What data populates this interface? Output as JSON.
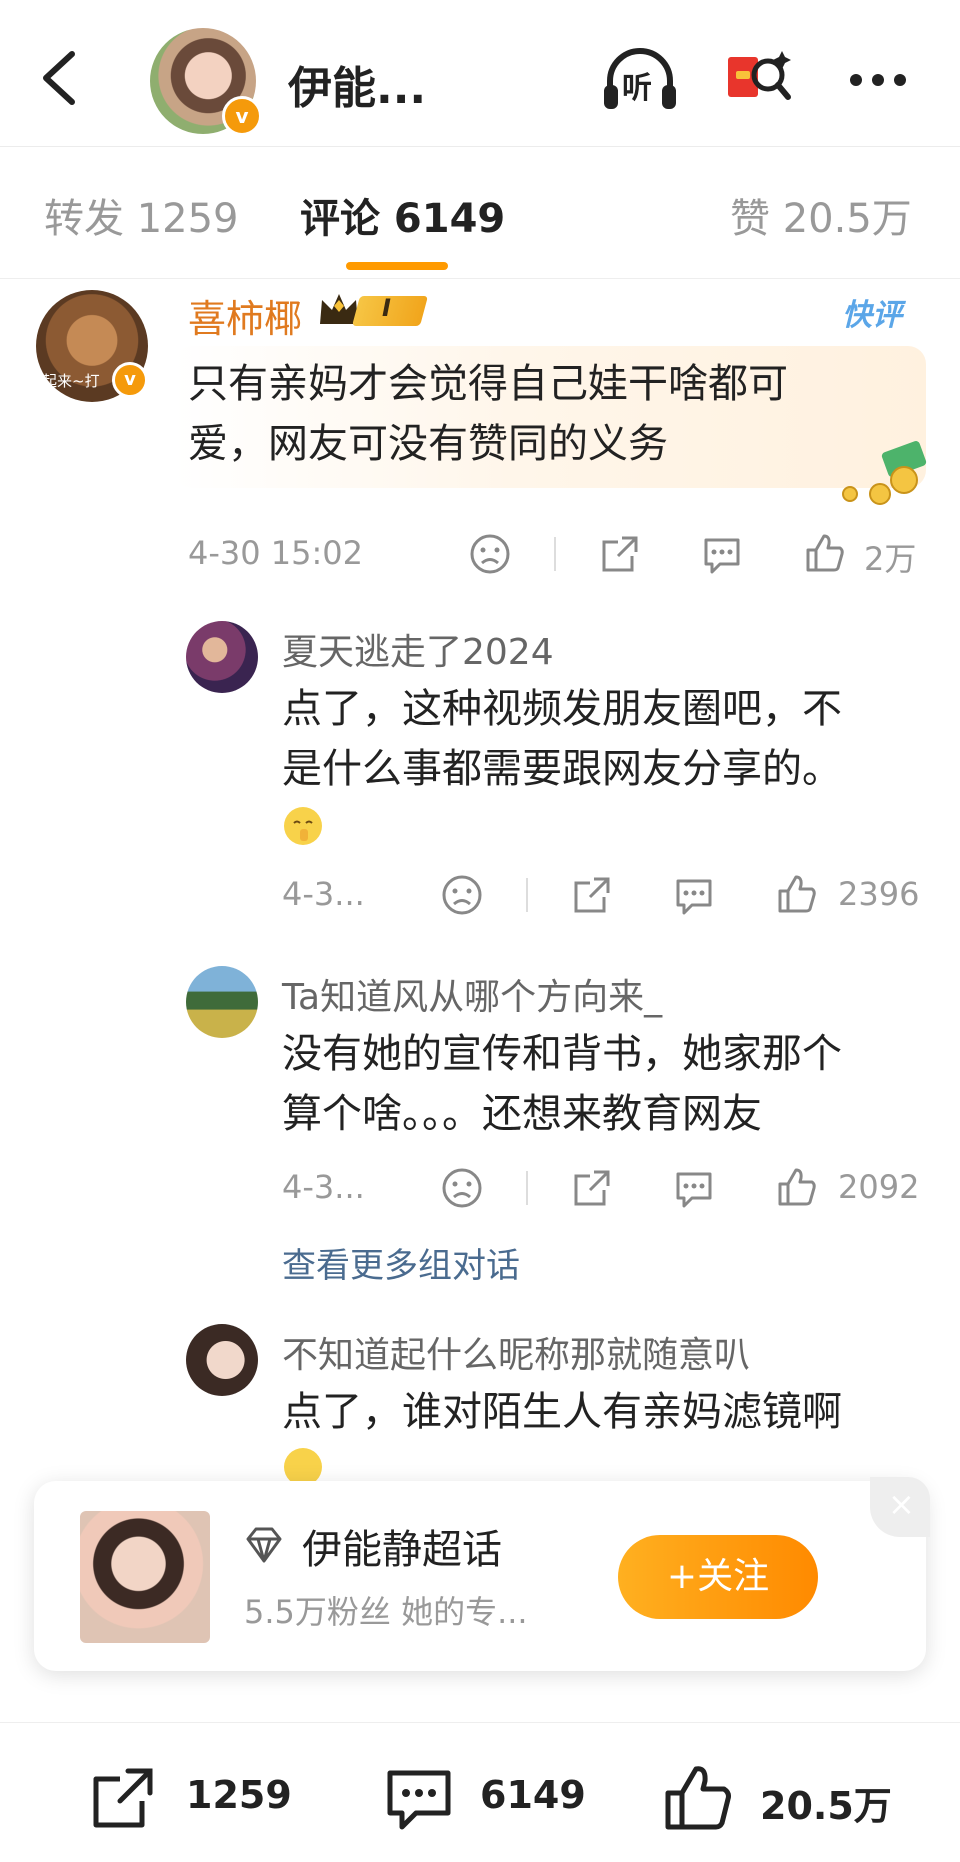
{
  "header": {
    "title": "伊能...",
    "v_badge": "v",
    "listen_label": "听"
  },
  "tabs": [
    {
      "label": "转发 1259"
    },
    {
      "label": "评论 6149"
    },
    {
      "label": "赞 20.5万"
    }
  ],
  "comment": {
    "username": "喜柿椰",
    "level": "I",
    "tag": "快评",
    "text_line1": "只有亲妈才会觉得自己娃干啥都可",
    "text_line2": "爱，网友可没有赞同的义务",
    "avatar_caption": "起来~打",
    "time": "4-30 15:02",
    "likes": "2万"
  },
  "replies": [
    {
      "username": "夏天逃走了2024",
      "line1": "点了，这种视频发朋友圈吧，不",
      "line2": "是什么事都需要跟网友分享的。",
      "time": "4-3...",
      "likes": "2396"
    },
    {
      "username": "Ta知道风从哪个方向来_",
      "line1": "没有她的宣传和背书，她家那个",
      "line2": "算个啥。。。还想来教育网友",
      "time": "4-3...",
      "likes": "2092"
    }
  ],
  "more_link": "查看更多组对话",
  "reply3": {
    "username": "不知道起什么昵称那就随意叭",
    "line1": "点了，谁对陌生人有亲妈滤镜啊"
  },
  "supertopic": {
    "name": "伊能静超话",
    "subtitle": "5.5万粉丝 她的专...",
    "follow_label": "+关注",
    "close": "×"
  },
  "bottom": {
    "repost": "1259",
    "comment": "6149",
    "like": "20.5万"
  },
  "colors": {
    "accent": "#ff9a00",
    "username_orange": "#e07a1f",
    "link_blue": "#4a6b8f"
  }
}
